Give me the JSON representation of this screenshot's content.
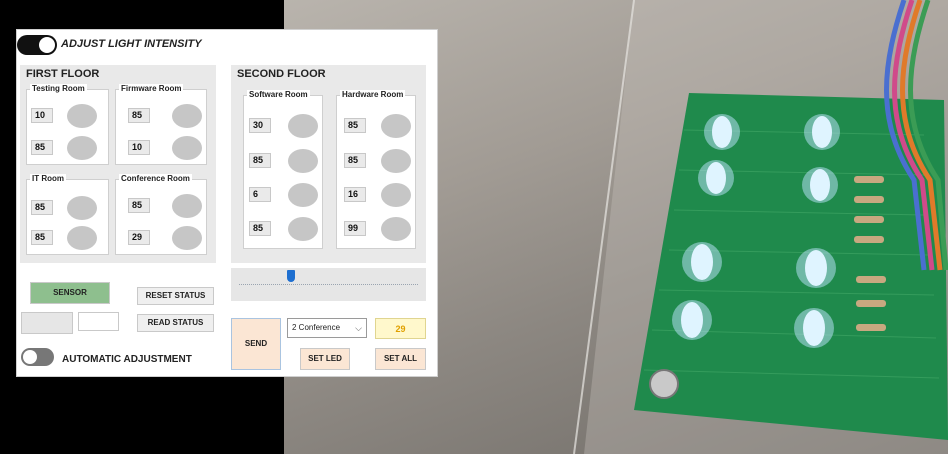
{
  "header": {
    "title": "ADJUST LIGHT INTENSITY"
  },
  "first_floor": {
    "title": "FIRST FLOOR",
    "rooms": [
      {
        "name": "Testing Room",
        "values": [
          "10",
          "85"
        ]
      },
      {
        "name": "Firmware Room",
        "values": [
          "85",
          "10"
        ]
      },
      {
        "name": "IT Room",
        "values": [
          "85",
          "85"
        ]
      },
      {
        "name": "Conference Room",
        "values": [
          "85",
          "29"
        ]
      }
    ]
  },
  "second_floor": {
    "title": "SECOND FLOOR",
    "rooms": [
      {
        "name": "Software Room",
        "values": [
          "30",
          "85",
          "6",
          "85"
        ]
      },
      {
        "name": "Hardware Room",
        "values": [
          "85",
          "85",
          "16",
          "99"
        ]
      }
    ]
  },
  "buttons": {
    "sensor": "SENSOR",
    "reset_status": "RESET STATUS",
    "read_status": "READ STATUS",
    "send": "SEND",
    "set_led": "SET LED",
    "set_all": "SET ALL"
  },
  "auto": {
    "label": "AUTOMATIC ADJUSTMENT"
  },
  "controls": {
    "selected_room": "2 Conference",
    "value": "29"
  },
  "colors": {
    "led_glow": "#bfe6ff",
    "pcb": "#1f8a4c",
    "sensor_button": "#8ebf8e"
  }
}
